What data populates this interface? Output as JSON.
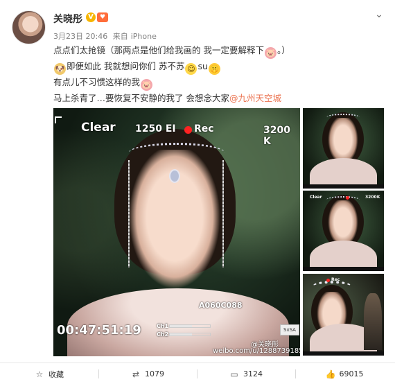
{
  "post": {
    "username": "关晓彤",
    "verified_badge": "V",
    "vip_badge": "♥",
    "date": "3月23日 20:46",
    "source_prefix": "来自",
    "source": "iPhone",
    "lines": [
      {
        "text": "点点们太抢镜（那两点是他们给我画的 我一定要解释下",
        "emoji_after": "pig-emoji",
        "tail": "。）"
      },
      {
        "emoji_before": "dog-emoji",
        "text": "即便如此 我就想问你们 苏不苏",
        "emoji_after": "smile-emoji",
        "mid": "su",
        "emoji_after2": "shh-emoji"
      },
      {
        "text": "有点儿不习惯这样的我",
        "emoji_after": "pig-emoji"
      },
      {
        "text": "马上杀青了…要恢复不安静的我了 会想念大家",
        "mention": "@九州天空城"
      }
    ]
  },
  "photo": {
    "hud_clear": "Clear",
    "hud_el": "1250 EI",
    "hud_rec": "Rec",
    "hud_k": "3200 K",
    "hud_timecode": "00:47:51:19",
    "hud_clip": "A060C088",
    "hud_ch1": "Ch1",
    "hud_ch2": "Ch2",
    "hud_sxsa": "SxSA",
    "watermark_handle": "@关晓彤",
    "watermark_url": "weibo.com/u/1288739185",
    "meter_ch1": 0.55,
    "meter_ch2": 0.55
  },
  "thumbs": [
    {
      "hud_left": "",
      "hud_right": ""
    },
    {
      "hud_left": "Clear",
      "hud_right": "3200K"
    },
    {
      "hud_left": "",
      "hud_right": "Rec"
    }
  ],
  "actions": {
    "favorite_label": "收藏",
    "repost_count": "1079",
    "comment_count": "3124",
    "like_count": "69015"
  },
  "icons": {
    "chevron": "chevron-down-icon",
    "favorite": "star-outline-icon",
    "repost": "repost-icon",
    "comment": "comment-icon",
    "like": "thumbs-up-icon"
  },
  "colors": {
    "mention": "#eb7350",
    "verified_badge": "#f7b500",
    "rec_dot": "#ff2222"
  }
}
